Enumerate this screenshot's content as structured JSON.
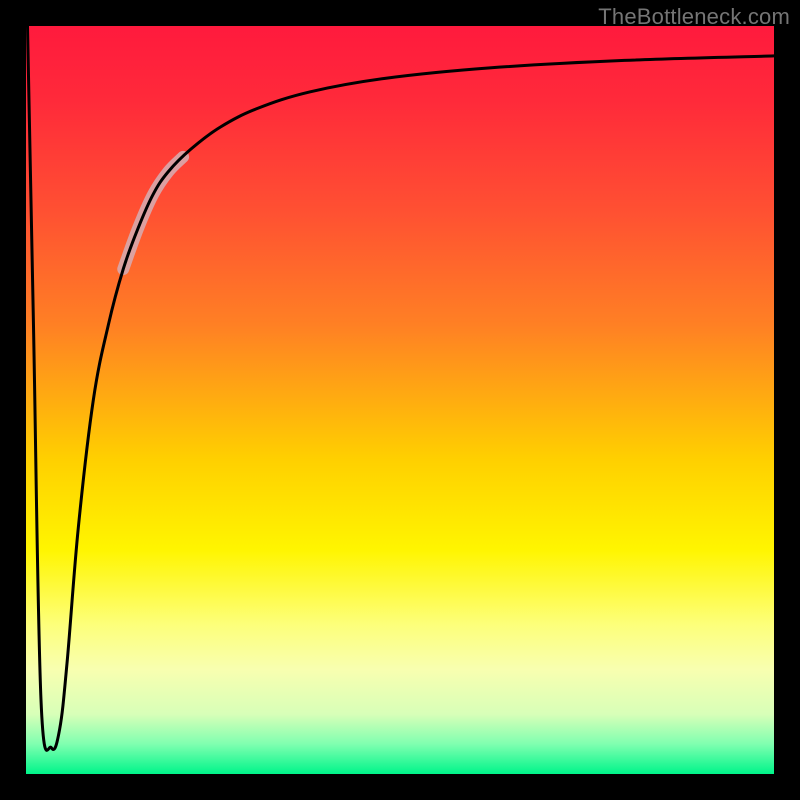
{
  "attribution": "TheBottleneck.com",
  "chart_data": {
    "type": "line",
    "title": "",
    "xlabel": "",
    "ylabel": "",
    "xlim": [
      0,
      100
    ],
    "ylim": [
      0,
      100
    ],
    "gradient_stops": [
      {
        "pos": 0.0,
        "color": "#ff1a3d"
      },
      {
        "pos": 0.1,
        "color": "#ff2a3a"
      },
      {
        "pos": 0.25,
        "color": "#ff5132"
      },
      {
        "pos": 0.4,
        "color": "#ff8024"
      },
      {
        "pos": 0.58,
        "color": "#ffd000"
      },
      {
        "pos": 0.7,
        "color": "#fff500"
      },
      {
        "pos": 0.8,
        "color": "#fdff7a"
      },
      {
        "pos": 0.86,
        "color": "#f8ffb0"
      },
      {
        "pos": 0.92,
        "color": "#d8ffb8"
      },
      {
        "pos": 0.96,
        "color": "#7fffb0"
      },
      {
        "pos": 1.0,
        "color": "#00f58a"
      }
    ],
    "series": [
      {
        "name": "main-curve",
        "color": "#000000",
        "width": 3,
        "x": [
          0.2,
          1.0,
          2.0,
          3.4,
          4.5,
          5.5,
          7.0,
          9.0,
          11.0,
          13.0,
          15.0,
          17.0,
          19.0,
          22.0,
          26.0,
          31.0,
          38.0,
          48.0,
          62.0,
          80.0,
          100.0
        ],
        "y": [
          100.0,
          60.0,
          10.0,
          3.5,
          6.0,
          15.0,
          33.0,
          50.0,
          60.0,
          67.5,
          73.0,
          77.5,
          80.5,
          83.5,
          86.5,
          89.0,
          91.2,
          93.0,
          94.4,
          95.4,
          96.0
        ]
      },
      {
        "name": "highlight-segment",
        "color": "#d8a8ad",
        "width": 12,
        "opacity": 0.9,
        "x": [
          13.0,
          15.0,
          17.0,
          19.0,
          21.0
        ],
        "y": [
          67.5,
          73.0,
          77.5,
          80.5,
          82.5
        ]
      }
    ]
  }
}
